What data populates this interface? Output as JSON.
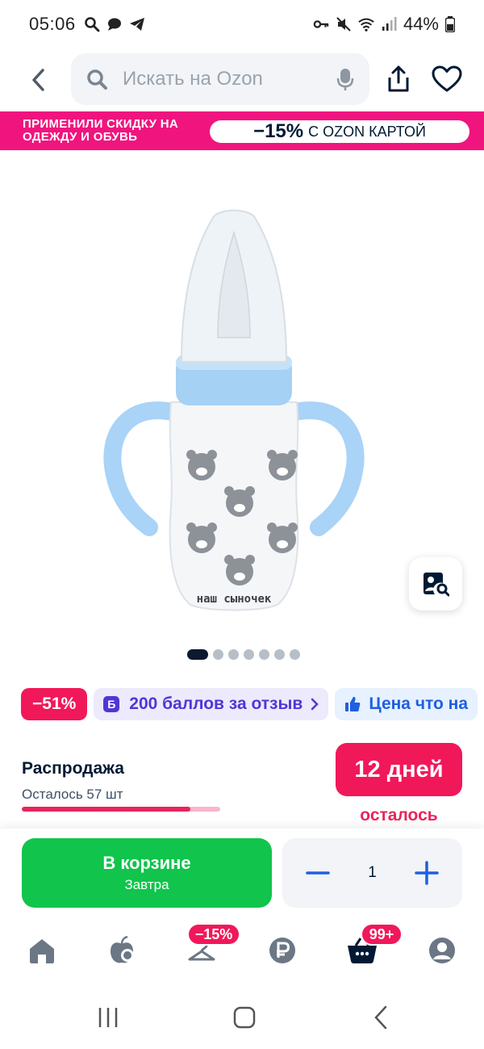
{
  "status_bar": {
    "time": "05:06",
    "battery": "44%"
  },
  "header": {
    "search_placeholder": "Искать на Ozon"
  },
  "promo": {
    "text": "ПРИМЕНИЛИ СКИДКУ НА ОДЕЖДУ И ОБУВЬ",
    "percent": "−15%",
    "rest": "С OZON КАРТОЙ"
  },
  "product_image": {
    "bottle_label": "наш сыночек"
  },
  "pager": {
    "total": 7,
    "active_index": 0
  },
  "chips": {
    "discount": "−51%",
    "points_icon": "Б",
    "points": "200 баллов за отзыв",
    "price": "Цена что на"
  },
  "sale": {
    "title": "Распродажа",
    "left_label": "Осталось 57 шт",
    "progress_fraction": 0.85,
    "days": "12 дней",
    "days_suffix": "осталось"
  },
  "action": {
    "cart_label": "В корзине",
    "cart_sub": "Завтра",
    "quantity": "1"
  },
  "bottom_nav": {
    "promo_badge": "−15%",
    "cart_badge": "99+"
  },
  "colors": {
    "brand_pink": "#f0147f",
    "sale_red": "#f1185a",
    "cart_green": "#10c44c",
    "link_blue": "#1f5fe0",
    "points_purple": "#5135d6"
  }
}
